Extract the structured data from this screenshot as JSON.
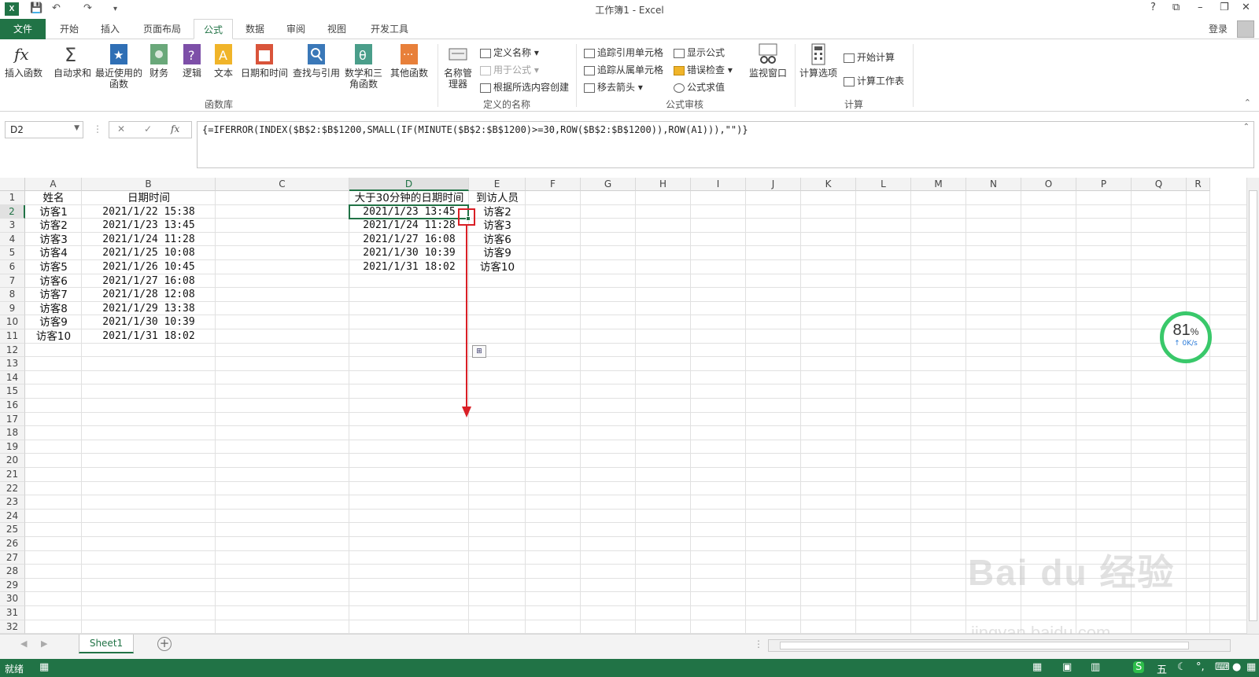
{
  "window": {
    "title": "工作簿1 - Excel",
    "logo_text": "X",
    "controls": [
      "?",
      "⧉",
      "–",
      "❐",
      "✕"
    ]
  },
  "tabs": {
    "file": "文件",
    "items": [
      "开始",
      "插入",
      "页面布局",
      "公式",
      "数据",
      "审阅",
      "视图",
      "开发工具"
    ],
    "active": "公式",
    "login": "登录"
  },
  "ribbon": {
    "function_library": {
      "label": "函数库",
      "buttons": [
        "插入函数",
        "自动求和",
        "最近使用的函数",
        "财务",
        "逻辑",
        "文本",
        "日期和时间",
        "查找与引用",
        "数学和三角函数",
        "其他函数"
      ]
    },
    "defined_names": {
      "label": "定义的名称",
      "name_manager": "名称管理器",
      "define_name": "定义名称",
      "use_in_formula": "用于公式",
      "create_from_selection": "根据所选内容创建"
    },
    "formula_auditing": {
      "label": "公式审核",
      "trace_precedents": "追踪引用单元格",
      "trace_dependents": "追踪从属单元格",
      "remove_arrows": "移去箭头",
      "show_formulas": "显示公式",
      "error_checking": "错误检查",
      "evaluate_formula": "公式求值",
      "watch_window": "监视窗口"
    },
    "calculation": {
      "label": "计算",
      "calc_options": "计算选项",
      "calc_now": "开始计算",
      "calc_sheet": "计算工作表"
    }
  },
  "formula_bar": {
    "name_box": "D2",
    "formula": "{=IFERROR(INDEX($B$2:$B$1200,SMALL(IF(MINUTE($B$2:$B$1200)>=30,ROW($B$2:$B$1200)),ROW(A1))),\"\")}"
  },
  "sheet": {
    "columns": [
      "A",
      "B",
      "C",
      "D",
      "E",
      "F",
      "G",
      "H",
      "I",
      "J",
      "K",
      "L",
      "M",
      "N",
      "O",
      "P",
      "Q",
      "R"
    ],
    "selected_column": "D",
    "selected_row": "2",
    "row_numbers": [
      "1",
      "2",
      "3",
      "4",
      "5",
      "6",
      "7",
      "8",
      "9",
      "10",
      "11",
      "12",
      "13",
      "14",
      "15",
      "16",
      "17",
      "18",
      "19",
      "20",
      "21",
      "22",
      "23",
      "24",
      "25",
      "26",
      "27",
      "28",
      "29",
      "30",
      "31",
      "32"
    ],
    "headers": {
      "a": "姓名",
      "b": "日期时间",
      "d": "大于30分钟的日期时间",
      "e": "到访人员"
    },
    "col_a": [
      "访客1",
      "访客2",
      "访客3",
      "访客4",
      "访客5",
      "访客6",
      "访客7",
      "访客8",
      "访客9",
      "访客10"
    ],
    "col_b": [
      "2021/1/22 15:38",
      "2021/1/23 13:45",
      "2021/1/24 11:28",
      "2021/1/25 10:08",
      "2021/1/26 10:45",
      "2021/1/27 16:08",
      "2021/1/28 12:08",
      "2021/1/29 13:38",
      "2021/1/30 10:39",
      "2021/1/31 18:02"
    ],
    "col_d": [
      "2021/1/23 13:45",
      "2021/1/24 11:28",
      "2021/1/27 16:08",
      "2021/1/30 10:39",
      "2021/1/31 18:02"
    ],
    "col_e": [
      "访客2",
      "访客3",
      "访客6",
      "访客9",
      "访客10"
    ]
  },
  "sheet_tabs": {
    "active": "Sheet1"
  },
  "status": {
    "ready": "就绪"
  },
  "speed_widget": {
    "percent": "81",
    "percent_sign": "%",
    "rate": "↑ 0K/s"
  },
  "watermark": {
    "brand": "Bai du 经验",
    "url": "jingyan.baidu.com"
  },
  "colors": {
    "accent": "#217346",
    "annotation": "#d91f26",
    "speed_ring": "#39c86a"
  }
}
